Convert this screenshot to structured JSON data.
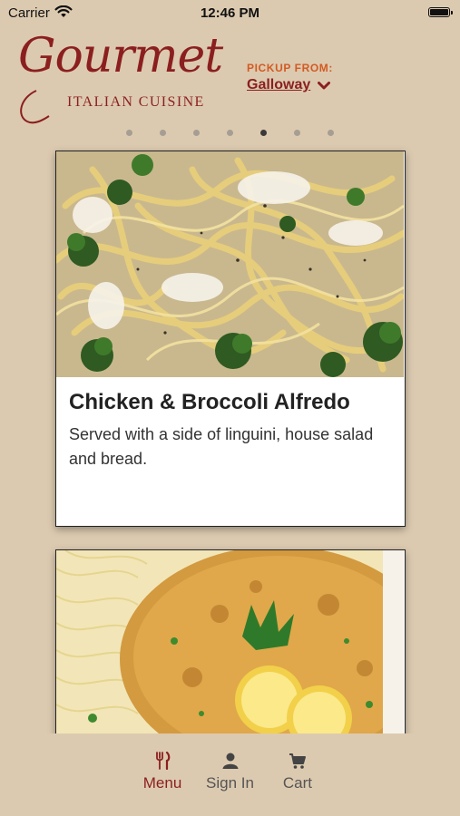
{
  "status_bar": {
    "carrier": "Carrier",
    "time": "12:46 PM"
  },
  "header": {
    "logo_script": "Gourmet",
    "logo_subtitle": "ITALIAN CUISINE",
    "pickup_label": "PICKUP FROM:",
    "pickup_location": "Galloway",
    "brand_color": "#8b1f1f",
    "accent_color": "#d35a22"
  },
  "pager": {
    "total": 7,
    "active_index": 4
  },
  "cards": [
    {
      "title": "Chicken & Broccoli Alfredo",
      "description": "Served with a side of linguini, house salad and bread.",
      "image": "pasta-alfredo-photo"
    },
    {
      "title": "",
      "description": "",
      "image": "chicken-francese-photo"
    }
  ],
  "tabbar": {
    "items": [
      {
        "label": "Menu",
        "icon": "fork-knife-icon",
        "active": true
      },
      {
        "label": "Sign In",
        "icon": "person-icon",
        "active": false
      },
      {
        "label": "Cart",
        "icon": "cart-icon",
        "active": false
      }
    ]
  }
}
